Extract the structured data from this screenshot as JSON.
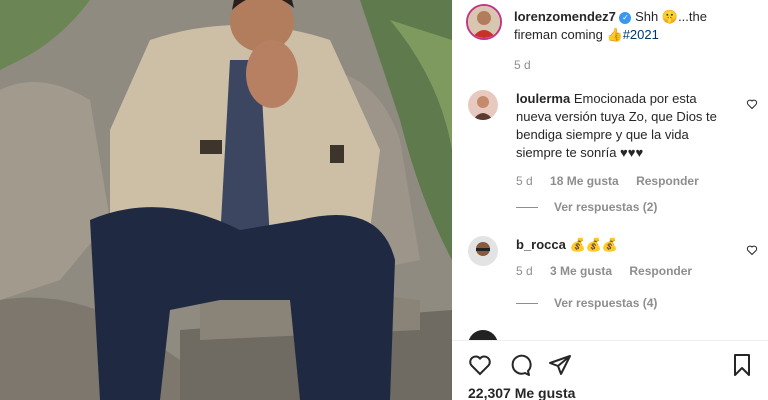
{
  "post": {
    "author": "lorenzomendez7",
    "caption_prefix": "Shh",
    "caption_emoji": "🤫",
    "caption_rest": "...the",
    "caption_line2": "fireman coming",
    "caption_emoji2": "👍",
    "hashtag": "#2021",
    "time": "5 d"
  },
  "comments": [
    {
      "username": "loulerma",
      "text": "Emocionada por esta nueva versión tuya Zo, que Dios te bendiga siempre y que la vida siempre te sonría ♥♥♥",
      "time": "5 d",
      "likes": "18 Me gusta",
      "reply_label": "Responder",
      "view_replies": "Ver respuestas (2)"
    },
    {
      "username": "b_rocca",
      "text": "💰💰💰",
      "time": "5 d",
      "likes": "3 Me gusta",
      "reply_label": "Responder",
      "view_replies": "Ver respuestas (4)"
    }
  ],
  "footer": {
    "likes_count": "22,307 Me gusta"
  },
  "icons": {
    "like": "heart-icon",
    "comment": "comment-icon",
    "share": "share-icon",
    "save": "bookmark-icon"
  },
  "colors": {
    "hashtag": "#00376b",
    "meta": "#8e8e8e",
    "verified": "#3897f0"
  }
}
